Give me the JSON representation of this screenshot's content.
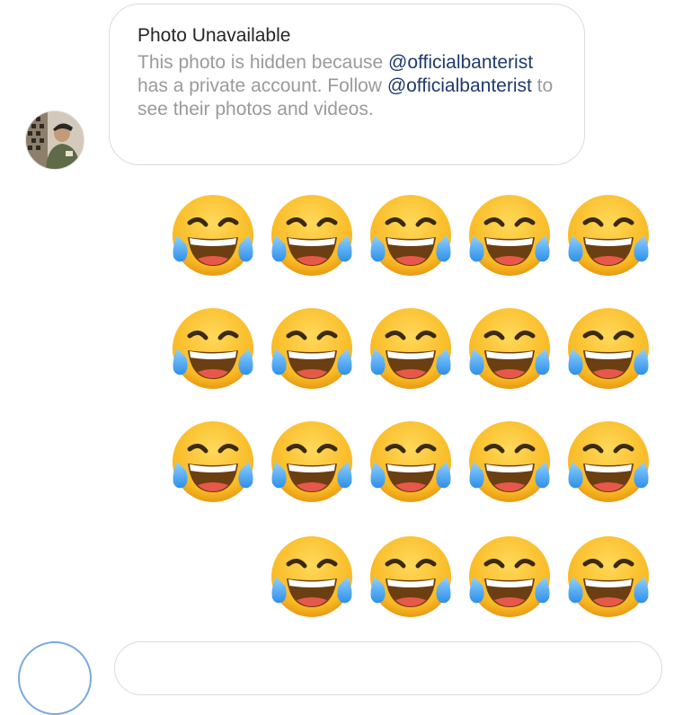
{
  "message": {
    "title": "Photo Unavailable",
    "body_prefix": "This photo is hidden because",
    "mention_1": "@officialbanterist",
    "body_middle": " has a private account. Follow ",
    "mention_2": "@officialbanterist",
    "body_suffix": " to see their photos and videos."
  },
  "reaction": {
    "icon": "face-with-tears-of-joy-icon",
    "rows": [
      5,
      5,
      5,
      4
    ]
  },
  "colors": {
    "mention": "#1f3a6e",
    "secondary_text": "#9a9a9a",
    "bubble_border": "#dbdbdb"
  }
}
